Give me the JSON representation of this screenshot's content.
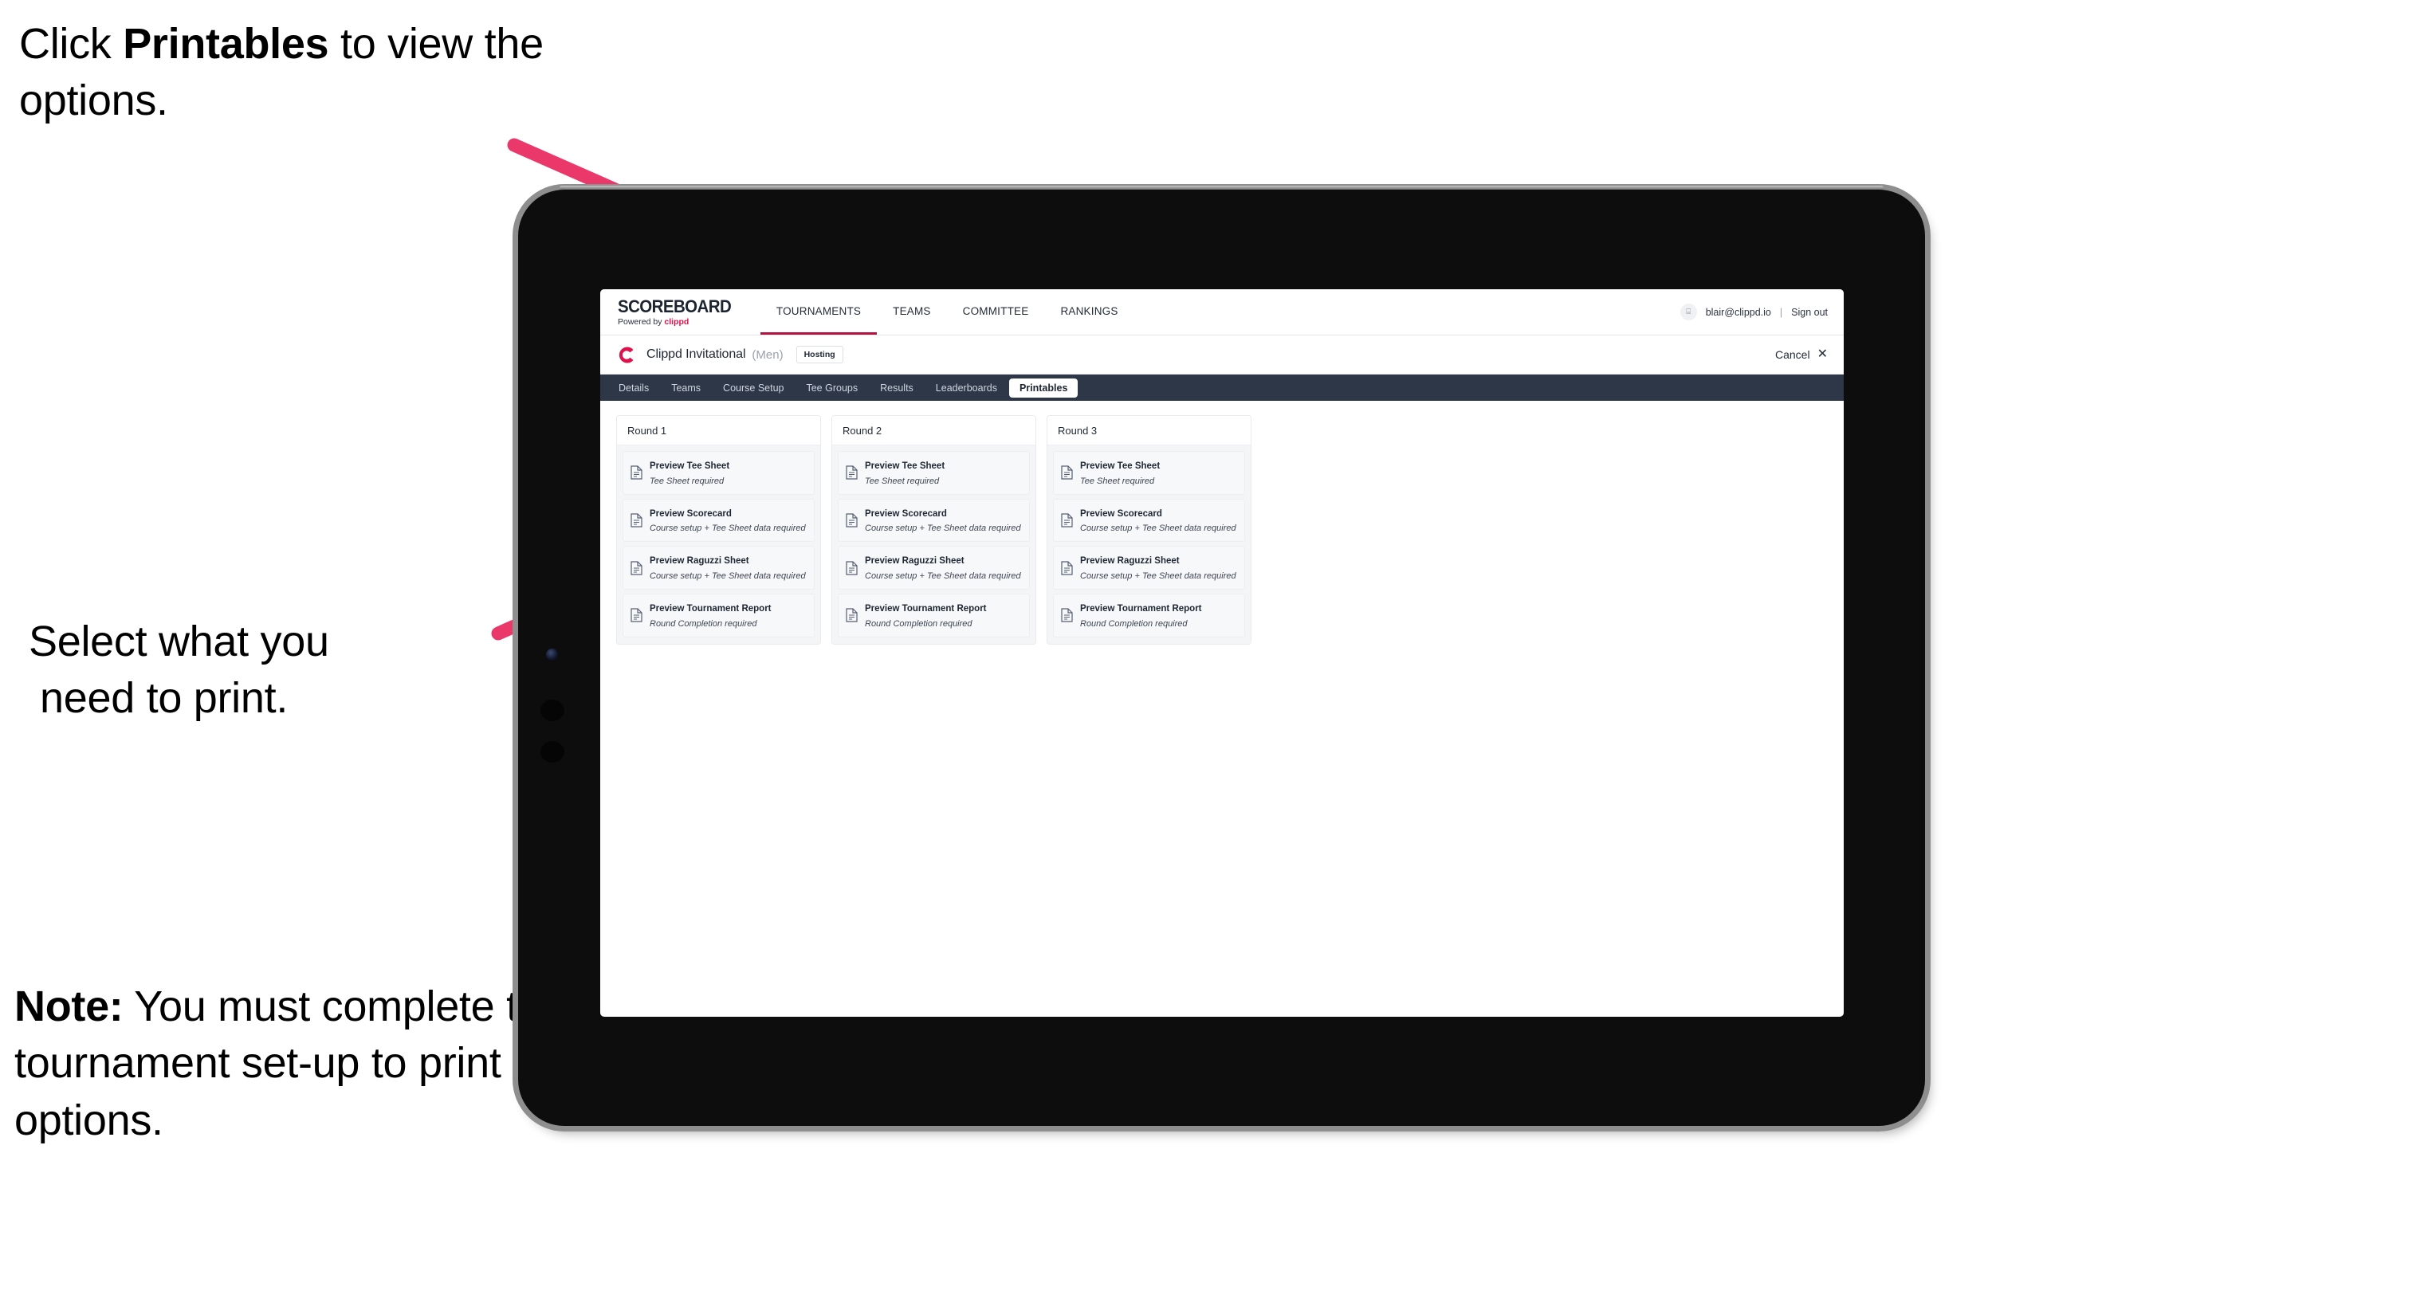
{
  "annotations": {
    "top": {
      "pre": "Click ",
      "bold": "Printables",
      "post": " to view the options."
    },
    "middle": {
      "line1": "Select what you",
      "line2": "need to print."
    },
    "note": {
      "bold": "Note:",
      "text": " You must complete the tournament set-up to print all the options."
    },
    "arrow_color": "#ea386b"
  },
  "app": {
    "brand": {
      "title": "SCOREBOARD",
      "powered_prefix": "Powered by ",
      "powered_name": "clippd"
    },
    "main_menu": [
      {
        "label": "TOURNAMENTS",
        "active": true
      },
      {
        "label": "TEAMS",
        "active": false
      },
      {
        "label": "COMMITTEE",
        "active": false
      },
      {
        "label": "RANKINGS",
        "active": false
      }
    ],
    "account": {
      "avatar_glyph": "⌸",
      "email": "blair@clippd.io",
      "separator": "|",
      "sign_out": "Sign out"
    },
    "tournament": {
      "name": "Clippd Invitational",
      "gender": "(Men)",
      "status_badge": "Hosting",
      "cancel_label": "Cancel",
      "cancel_icon": "✕"
    },
    "sub_tabs": [
      {
        "label": "Details",
        "active": false
      },
      {
        "label": "Teams",
        "active": false
      },
      {
        "label": "Course Setup",
        "active": false
      },
      {
        "label": "Tee Groups",
        "active": false
      },
      {
        "label": "Results",
        "active": false
      },
      {
        "label": "Leaderboards",
        "active": false
      },
      {
        "label": "Printables",
        "active": true
      }
    ],
    "printables": {
      "columns": [
        {
          "header": "Round 1",
          "items": [
            {
              "title": "Preview Tee Sheet",
              "requirement": "Tee Sheet required"
            },
            {
              "title": "Preview Scorecard",
              "requirement": "Course setup + Tee Sheet data required"
            },
            {
              "title": "Preview Raguzzi Sheet",
              "requirement": "Course setup + Tee Sheet data required"
            },
            {
              "title": "Preview Tournament Report",
              "requirement": "Round Completion required"
            }
          ]
        },
        {
          "header": "Round 2",
          "items": [
            {
              "title": "Preview Tee Sheet",
              "requirement": "Tee Sheet required"
            },
            {
              "title": "Preview Scorecard",
              "requirement": "Course setup + Tee Sheet data required"
            },
            {
              "title": "Preview Raguzzi Sheet",
              "requirement": "Course setup + Tee Sheet data required"
            },
            {
              "title": "Preview Tournament Report",
              "requirement": "Round Completion required"
            }
          ]
        },
        {
          "header": "Round 3",
          "items": [
            {
              "title": "Preview Tee Sheet",
              "requirement": "Tee Sheet required"
            },
            {
              "title": "Preview Scorecard",
              "requirement": "Course setup + Tee Sheet data required"
            },
            {
              "title": "Preview Raguzzi Sheet",
              "requirement": "Course setup + Tee Sheet data required"
            },
            {
              "title": "Preview Tournament Report",
              "requirement": "Round Completion required"
            }
          ]
        }
      ]
    },
    "colors": {
      "accent_crimson": "#b01441",
      "brand_pink": "#e0104a",
      "subtab_bar": "#2d3748"
    }
  }
}
